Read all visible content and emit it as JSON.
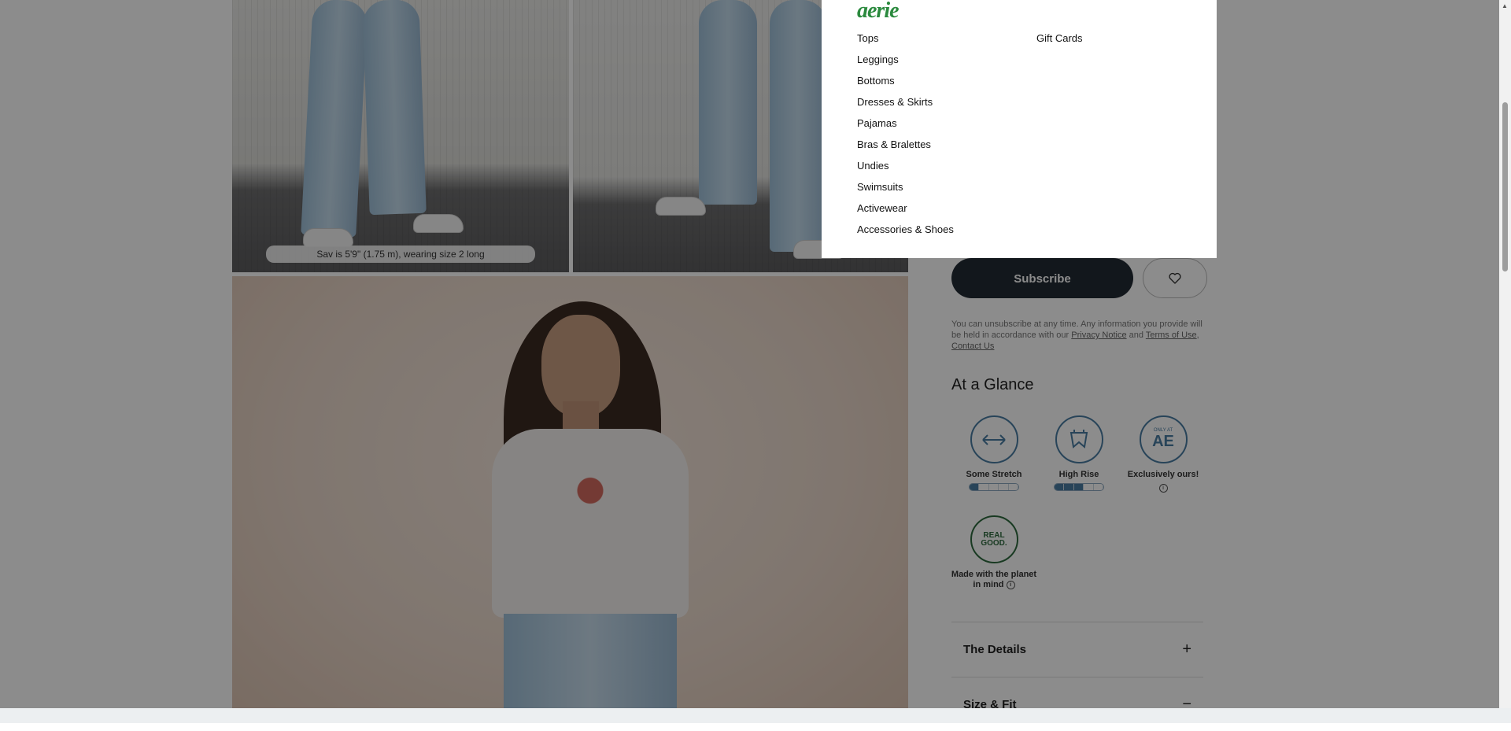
{
  "gallery": {
    "model_caption": "Sav is 5'9\" (1.75 m), wearing size 2 long"
  },
  "subscribe": {
    "button_label": "Subscribe",
    "disclaimer_text": "You can unsubscribe at any time. Any information you provide will be held in accordance with our ",
    "privacy_link": "Privacy Notice",
    "and_text": " and ",
    "terms_link": "Terms of Use",
    "separator": ", ",
    "contact_link": "Contact Us"
  },
  "at_a_glance": {
    "title": "At a Glance",
    "features": [
      {
        "label": "Some Stretch",
        "icon": "stretch-icon",
        "level": 0.2
      },
      {
        "label": "High Rise",
        "icon": "high-rise-icon",
        "level": 0.6
      },
      {
        "label": "Exclusively ours!",
        "icon": "only-at-ae-icon",
        "badge_top": "ONLY AT",
        "badge_main": "AE"
      },
      {
        "label": "Made with the planet in mind",
        "icon": "real-good-icon",
        "badge_text": "REAL GOOD."
      }
    ]
  },
  "accordion": {
    "details_label": "The Details",
    "size_fit_label": "Size & Fit"
  },
  "menu": {
    "brand": "aerie",
    "col1": [
      "Tops",
      "Leggings",
      "Bottoms",
      "Dresses & Skirts",
      "Pajamas",
      "Bras & Bralettes",
      "Undies",
      "Swimsuits",
      "Activewear",
      "Accessories & Shoes"
    ],
    "col2": [
      "Gift Cards"
    ]
  },
  "colors": {
    "brand_green": "#2b8a3e",
    "icon_blue": "#4a7da3",
    "button_dark": "#222a33"
  }
}
